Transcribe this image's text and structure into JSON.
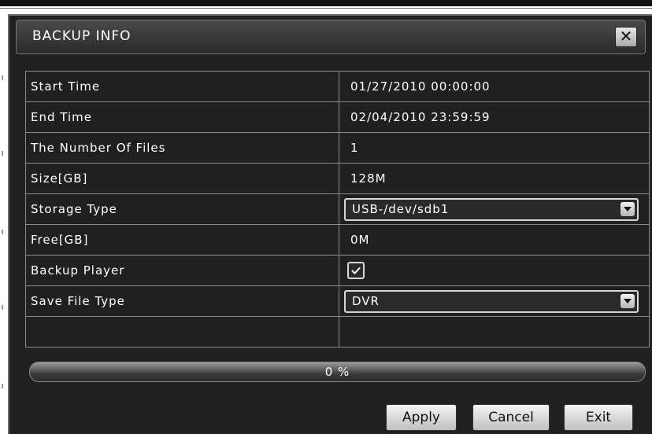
{
  "dialog": {
    "title": "BACKUP INFO",
    "close_glyph": "✕"
  },
  "rows": [
    {
      "label": "Start Time",
      "value": "01/27/2010 00:00:00"
    },
    {
      "label": "End Time",
      "value": "02/04/2010 23:59:59"
    },
    {
      "label": "The Number Of Files",
      "value": "1"
    },
    {
      "label": "Size[GB]",
      "value": "128M"
    },
    {
      "label": "Storage Type",
      "value": "USB-/dev/sdb1"
    },
    {
      "label": "Free[GB]",
      "value": "0M"
    },
    {
      "label": "Backup Player",
      "checked": true
    },
    {
      "label": "Save File Type",
      "value": "DVR"
    }
  ],
  "progress": {
    "text": "0 %",
    "value": 0
  },
  "buttons": {
    "apply": "Apply",
    "cancel": "Cancel",
    "exit": "Exit"
  },
  "icons": {
    "close": "close-icon",
    "dropdown": "chevron-down-icon",
    "check": "check-icon"
  },
  "colors": {
    "dialog_bg": "#202020",
    "grid_line": "#8a8a8a",
    "text": "#ffffff"
  }
}
